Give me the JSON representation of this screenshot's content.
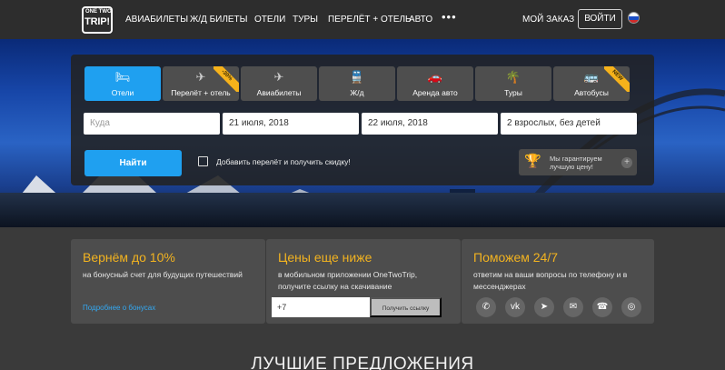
{
  "header": {
    "logo_top": "ONE TWO",
    "logo_main": "TRIP!",
    "nav": [
      "АВИАБИЛЕТЫ",
      "Ж/Д БИЛЕТЫ",
      "ОТЕЛИ",
      "ТУРЫ",
      "ПЕРЕЛЁТ + ОТЕЛЬ",
      "АВТО"
    ],
    "more": "•••",
    "my_order": "МОЙ ЗАКАЗ",
    "login": "ВОЙТИ"
  },
  "search": {
    "tabs": [
      {
        "label": "Отели",
        "icon": "bed-icon",
        "badge": ""
      },
      {
        "label": "Перелёт + отель",
        "icon": "plane-bed-icon",
        "badge": "-30%"
      },
      {
        "label": "Авиабилеты",
        "icon": "plane-icon",
        "badge": ""
      },
      {
        "label": "Ж/д",
        "icon": "train-icon",
        "badge": ""
      },
      {
        "label": "Аренда авто",
        "icon": "car-icon",
        "badge": ""
      },
      {
        "label": "Туры",
        "icon": "palm-icon",
        "badge": ""
      },
      {
        "label": "Автобусы",
        "icon": "bus-icon",
        "badge": "NEW"
      }
    ],
    "destination_placeholder": "Куда",
    "checkin": "21 июля, 2018",
    "checkout": "22 июля, 2018",
    "guests": "2 взрослых, без детей",
    "find": "Найти",
    "add_flight": "Добавить перелёт и получить скидку!",
    "guarantee": "Мы гарантируем лучшую цену!"
  },
  "promos": {
    "bonus": {
      "title": "Вернём до 10%",
      "text": "на бонусный счет для будущих путешествий",
      "link": "Подробнее о бонусах"
    },
    "app": {
      "title": "Цены еще ниже",
      "text": "в мобильном приложении OneTwoTrip, получите ссылку на скачивание",
      "phone_value": "+7",
      "button": "Получить ссылку"
    },
    "support": {
      "title": "Поможем 24/7",
      "text": "ответим на ваши вопросы по телефону и в мессенджерах",
      "icons": [
        "phone-icon",
        "vk-icon",
        "telegram-icon",
        "messenger-icon",
        "viber-icon",
        "whatsapp-icon"
      ]
    }
  },
  "best_offers_title": "ЛУЧШИЕ ПРЕДЛОЖЕНИЯ",
  "colors": {
    "accent": "#1fa0f0",
    "promo_title": "#f2b320",
    "badge": "#f6b21b"
  }
}
